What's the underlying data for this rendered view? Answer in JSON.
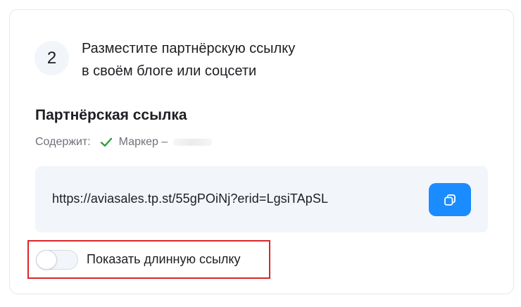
{
  "step": {
    "number": "2",
    "title_line1": "Разместите партнёрскую ссылку",
    "title_line2": "в своём блоге или соцсети"
  },
  "partner_link": {
    "section_title": "Партнёрская ссылка",
    "contains_label": "Содержит:",
    "marker_label": "Маркер –",
    "url": "https://aviasales.tp.st/55gPOiNj?erid=LgsiTApSL",
    "copy_icon": "copy-icon"
  },
  "toggle": {
    "label": "Показать длинную ссылку",
    "checked": false
  },
  "colors": {
    "accent": "#1a8cff",
    "check": "#2a9d3c",
    "highlight_border": "#d9262a"
  }
}
